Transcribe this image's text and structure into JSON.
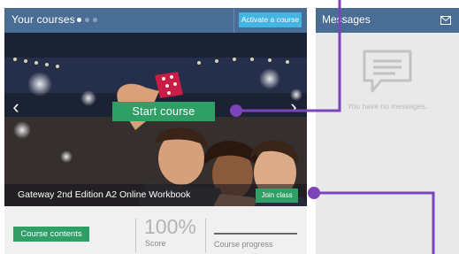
{
  "courses": {
    "title": "Your courses",
    "activate_label": "Activate a course",
    "dots_count": 3,
    "active_dot": 0,
    "hero": {
      "start_label": "Start course",
      "caption": "Gateway 2nd Edition  A2 Online Workbook",
      "join_label": "Join class",
      "prev_icon": "chevron-left-icon",
      "next_icon": "chevron-right-icon"
    },
    "footer": {
      "contents_label": "Course contents",
      "score_value": "100%",
      "score_label": "Score",
      "progress_label": "Course progress",
      "progress_fraction": 1.0
    }
  },
  "messages": {
    "title": "Messages",
    "icon": "mail-icon",
    "empty_icon": "chat-bubble-icon",
    "empty_text": "You have no messages."
  },
  "colors": {
    "header": "#4a6d96",
    "accent_green": "#2f9f66",
    "activate_blue": "#42b5e2",
    "annotation_purple": "#7b44b8"
  }
}
